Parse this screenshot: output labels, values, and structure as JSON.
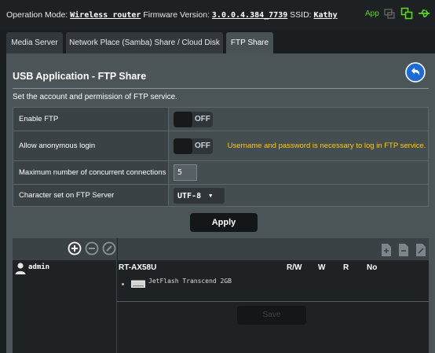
{
  "topbar": {
    "operation_mode_label": "Operation Mode:",
    "operation_mode_value": "Wireless router",
    "firmware_label": "Firmware Version:",
    "firmware_value": "3.0.0.4.384_7739",
    "ssid_label": "SSID:",
    "ssid_value": "Kathy",
    "app_label": "App"
  },
  "tabs": [
    {
      "label": "Media Server"
    },
    {
      "label": "Network Place (Samba) Share / Cloud Disk"
    },
    {
      "label": "FTP Share"
    }
  ],
  "panel": {
    "title": "USB Application - FTP Share",
    "description": "Set the account and permission of FTP service."
  },
  "form": {
    "enable_ftp": {
      "label": "Enable FTP",
      "state": "OFF"
    },
    "anonymous": {
      "label": "Allow anonymous login",
      "state": "OFF",
      "note": "Username and password is necessary to log in FTP service."
    },
    "max_conn": {
      "label": "Maximum number of concurrent connections",
      "value": "5"
    },
    "charset": {
      "label": "Character set on FTP Server",
      "value": "UTF-8"
    }
  },
  "apply_label": "Apply",
  "accounts": {
    "user": "admin",
    "device": "RT-AX58U",
    "columns": [
      "R/W",
      "W",
      "R",
      "No"
    ],
    "drive": "JetFlash Transcend 2GB",
    "save_label": "Save"
  },
  "colors": {
    "accent_green": "#5cd31c",
    "warning": "#ffcc00",
    "back_button": "#1e6bd6"
  }
}
